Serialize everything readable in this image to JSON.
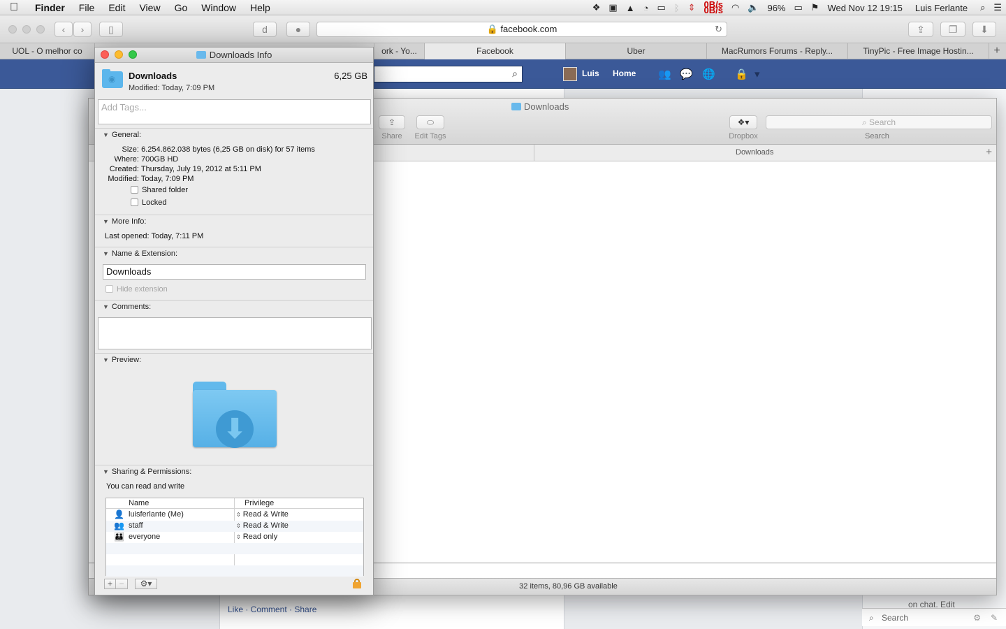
{
  "menubar": {
    "apple": "",
    "app": "Finder",
    "items": [
      "File",
      "Edit",
      "View",
      "Go",
      "Window",
      "Help"
    ],
    "netspeed_up": "0B/s",
    "netspeed_down": "0B/s",
    "battery": "96%",
    "datetime": "Wed Nov 12  19:15",
    "user": "Luis Ferlante"
  },
  "safari": {
    "url": "facebook.com",
    "tabs": [
      {
        "label": "UOL - O melhor co"
      },
      {
        "label": ""
      },
      {
        "label": "ork - Yo..."
      },
      {
        "label": "Facebook"
      },
      {
        "label": "Uber"
      },
      {
        "label": "MacRumors Forums - Reply..."
      },
      {
        "label": "TinyPic - Free Image Hostin..."
      }
    ]
  },
  "facebook": {
    "user": "Luis",
    "home": "Home",
    "post_actions": "Like · Comment · Share",
    "chat_text": "on chat. Edit",
    "chat_search": "Search"
  },
  "finder": {
    "title": "Downloads",
    "toolbar": {
      "share": "Share",
      "edit_tags": "Edit Tags",
      "dropbox": "Dropbox",
      "search_label": "Search",
      "search_placeholder": "Search"
    },
    "path_label": "Downloads",
    "status": "32 items, 80,96 GB available"
  },
  "info": {
    "title": "Downloads Info",
    "name": "Downloads",
    "size": "6,25 GB",
    "modified_line": "Modified: Today, 7:09 PM",
    "tags_placeholder": "Add Tags...",
    "general": {
      "title": "General:",
      "size_k": "Size:",
      "size_v": "6.254.862.038 bytes (6,25 GB on disk) for 57 items",
      "where_k": "Where:",
      "where_v": "700GB HD",
      "created_k": "Created:",
      "created_v": "Thursday, July 19, 2012 at 5:11 PM",
      "modified_k": "Modified:",
      "modified_v": "Today, 7:09 PM",
      "shared": "Shared folder",
      "locked": "Locked"
    },
    "more_info": {
      "title": "More Info:",
      "last_opened": "Last opened: Today, 7:11 PM"
    },
    "name_ext": {
      "title": "Name & Extension:",
      "value": "Downloads",
      "hide_ext": "Hide extension"
    },
    "comments": {
      "title": "Comments:"
    },
    "preview": {
      "title": "Preview:"
    },
    "sharing": {
      "title": "Sharing & Permissions:",
      "summary": "You can read and write",
      "col_name": "Name",
      "col_priv": "Privilege",
      "rows": [
        {
          "name": "luisferlante (Me)",
          "priv": "Read & Write"
        },
        {
          "name": "staff",
          "priv": "Read & Write"
        },
        {
          "name": "everyone",
          "priv": "Read only"
        }
      ]
    }
  },
  "colors": {
    "facebook_blue": "#3b5998",
    "folder_blue": "#5cb6ec",
    "lock_orange": "#f0a431"
  }
}
